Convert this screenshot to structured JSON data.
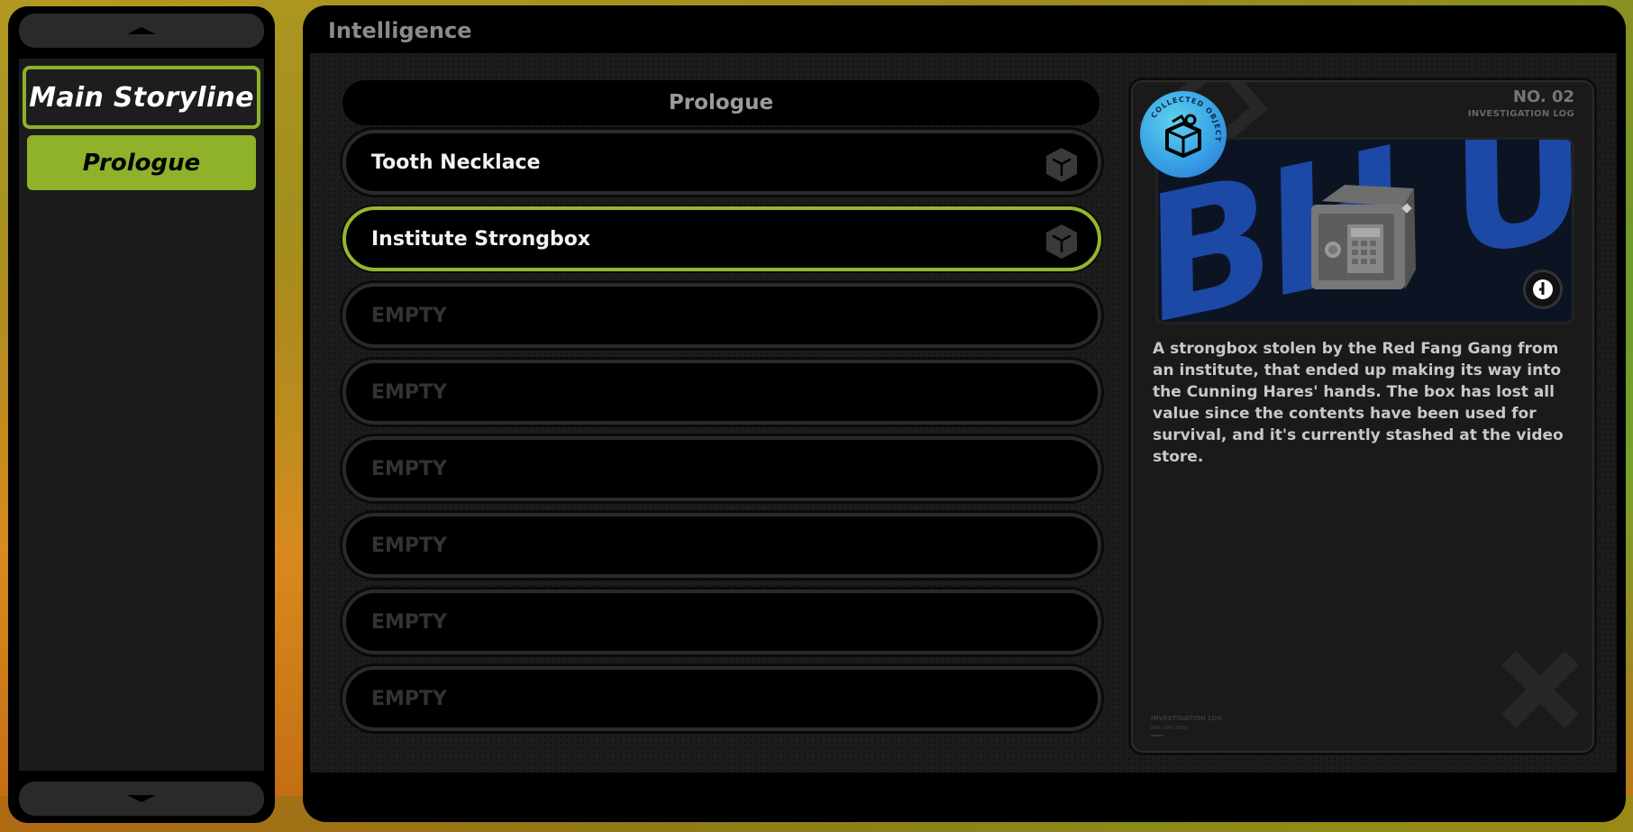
{
  "sidebar": {
    "scroll_up_icon": "triangle-up-icon",
    "scroll_down_icon": "triangle-down-icon",
    "items": [
      {
        "label": "Main Storyline",
        "state": "selected-category"
      },
      {
        "label": "Prologue",
        "state": "active-chapter"
      }
    ]
  },
  "window": {
    "title": "Intelligence"
  },
  "list": {
    "header": "Prologue",
    "rows": [
      {
        "label": "Tooth Necklace",
        "icon": "cube-icon",
        "selected": false,
        "empty": false
      },
      {
        "label": "Institute Strongbox",
        "icon": "cube-icon",
        "selected": true,
        "empty": false
      },
      {
        "label": "EMPTY",
        "empty": true
      },
      {
        "label": "EMPTY",
        "empty": true
      },
      {
        "label": "EMPTY",
        "empty": true
      },
      {
        "label": "EMPTY",
        "empty": true
      },
      {
        "label": "EMPTY",
        "empty": true
      },
      {
        "label": "EMPTY",
        "empty": true
      }
    ]
  },
  "detail": {
    "number": "NO. 02",
    "subtitle": "INVESTIGATION LOG",
    "badge_text": "COLLECTED OBJECT",
    "description": "A strongbox stolen by the Red Fang Gang from an institute, that ended up making its way into the Cunning Hares' hands. The box has lost all value since the contents have been used for survival, and it's currently stashed at the video store.",
    "footer_title": "INVESTIGATION LOG",
    "footer_sub": "HOLLOW ZERO",
    "photo_icon": "rotate-view-icon"
  },
  "colors": {
    "accent": "#8fb02a",
    "badge": "#3aa6e6",
    "photo_blue": "#1f4fb5"
  }
}
